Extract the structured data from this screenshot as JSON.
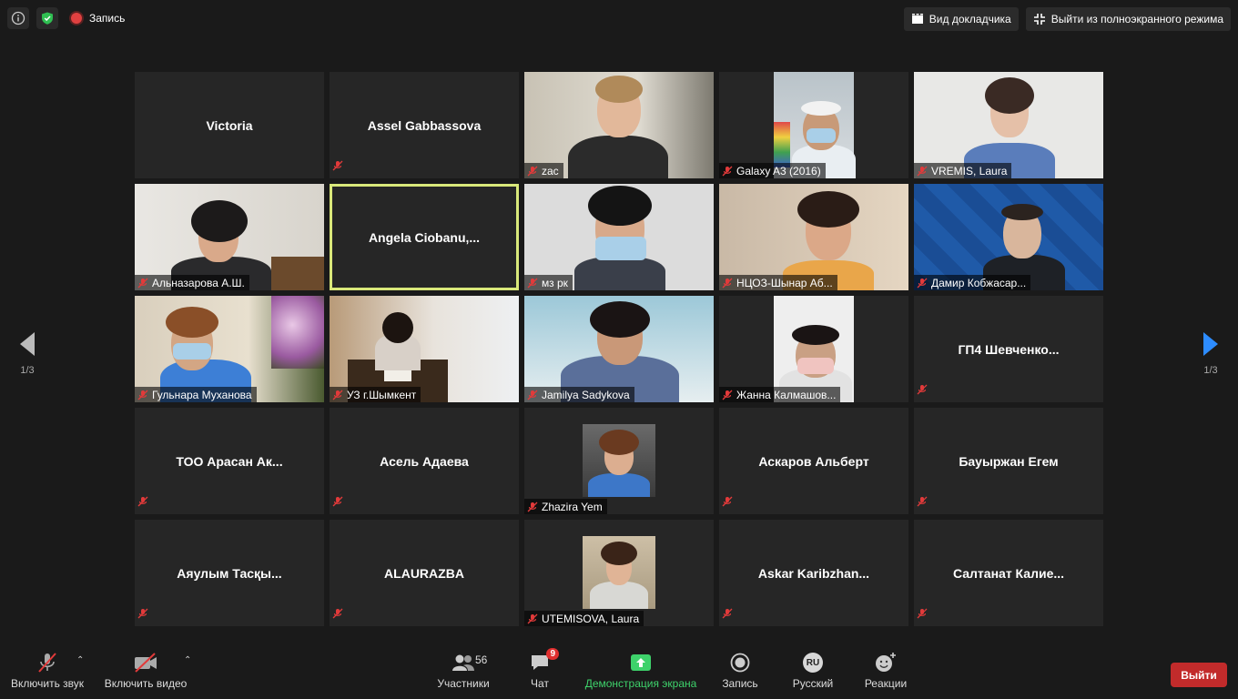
{
  "topbar": {
    "record_label": "Запись",
    "speaker_view": "Вид докладчика",
    "exit_fullscreen": "Выйти из полноэкранного режима"
  },
  "pagination": {
    "left": "1/3",
    "right": "1/3"
  },
  "participants": [
    {
      "name": "Victoria",
      "type": "name"
    },
    {
      "name": "Assel Gabbassova",
      "type": "name"
    },
    {
      "name": "zac",
      "type": "video"
    },
    {
      "name": "Galaxy A3 (2016)",
      "type": "video"
    },
    {
      "name": "VREMIS, Laura",
      "type": "video"
    },
    {
      "name": "Альназарова А.Ш.",
      "type": "video"
    },
    {
      "name": "Angela  Ciobanu,...",
      "type": "name"
    },
    {
      "name": "мз рк",
      "type": "video"
    },
    {
      "name": "НЦОЗ-Шынар Аб...",
      "type": "video"
    },
    {
      "name": "Дамир Кобжасар...",
      "type": "video"
    },
    {
      "name": "Гульнара Муханова",
      "type": "video"
    },
    {
      "name": "УЗ г.Шымкент",
      "type": "video"
    },
    {
      "name": "Jamilya Sadykova",
      "type": "video"
    },
    {
      "name": "Жанна Калмашов...",
      "type": "video"
    },
    {
      "name": "ГП4  Шевченко...",
      "type": "name"
    },
    {
      "name": "ТОО  Арасан  Ак...",
      "type": "name"
    },
    {
      "name": "Асель Адаева",
      "type": "name"
    },
    {
      "name": "Zhazira Yem",
      "type": "photo"
    },
    {
      "name": "Аскаров Альберт",
      "type": "name"
    },
    {
      "name": "Бауыржан Егем",
      "type": "name"
    },
    {
      "name": "Аяулым  Тасқы...",
      "type": "name"
    },
    {
      "name": "ALAURAZBA",
      "type": "name"
    },
    {
      "name": "UTEMISOVA, Laura",
      "type": "photo"
    },
    {
      "name": "Askar  Karibzhan...",
      "type": "name"
    },
    {
      "name": "Салтанат  Калие...",
      "type": "name"
    }
  ],
  "toolbar": {
    "audio": "Включить звук",
    "video": "Включить видео",
    "participants": "Участники",
    "participants_count": "56",
    "chat": "Чат",
    "chat_badge": "9",
    "share": "Демонстрация экрана",
    "record": "Запись",
    "language": "Русский",
    "language_code": "RU",
    "reactions": "Реакции",
    "leave": "Выйти"
  },
  "colors": {
    "accent_green": "#3ed26b",
    "leave_red": "#c22b2b",
    "active_border": "#d9e87a"
  }
}
